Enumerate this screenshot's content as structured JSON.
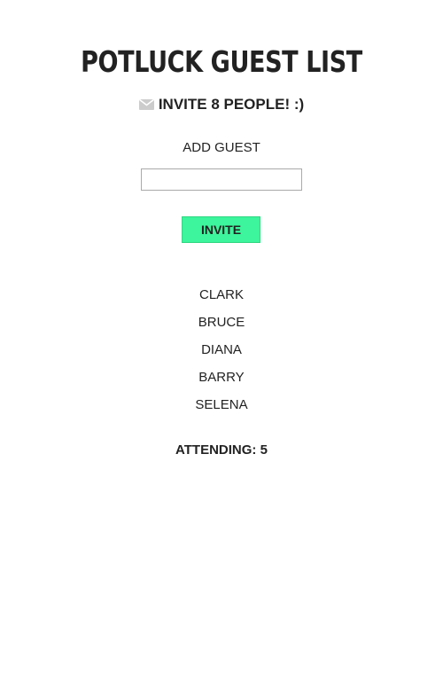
{
  "header": {
    "title": "POTLUCK GUEST LIST",
    "subtitle": "INVITE 8 PEOPLE! :)",
    "subtitle_icon": "envelope-icon"
  },
  "form": {
    "add_label": "ADD GUEST",
    "input_value": "",
    "input_placeholder": "",
    "invite_label": "INVITE"
  },
  "guests": [
    "CLARK",
    "BRUCE",
    "DIANA",
    "BARRY",
    "SELENA"
  ],
  "attending": {
    "label": "ATTENDING: 5"
  },
  "colors": {
    "invite_button": "#3cf59c",
    "icon": "#cccccc",
    "text": "#222222"
  }
}
